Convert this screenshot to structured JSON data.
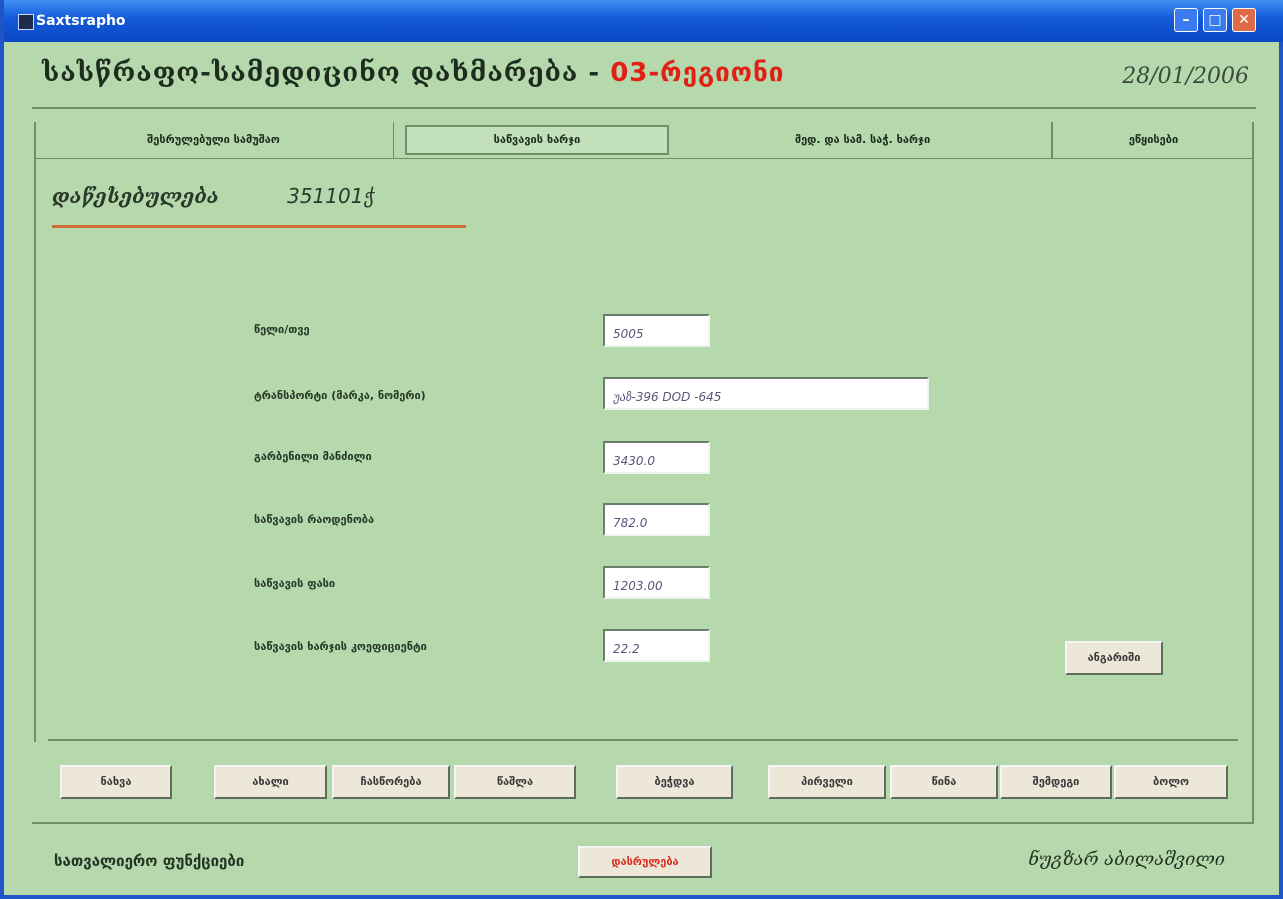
{
  "window": {
    "title": "Saxtsrapho"
  },
  "header": {
    "title_main": "სასწრაფო-სამედიცინო დახმარება - ",
    "title_accent": "03-რეგიონი",
    "date": "28/01/2006"
  },
  "tabs": [
    {
      "label": "შესრულებული სამუშაო"
    },
    {
      "label": "საწვავის ხარჯი"
    },
    {
      "label": "მედ. და სამ. საჭ. ხარჯი"
    },
    {
      "label": "ეწყისები"
    }
  ],
  "panel": {
    "label": "დაწესებულება",
    "code": "351101ჭ"
  },
  "fields": [
    {
      "label": "წელი/თვე",
      "value": "5005"
    },
    {
      "label": "ტრანსპორტი (მარკა, ნომერი)",
      "value": "უაზ-396 DOD -645"
    },
    {
      "label": "გარბენილი მანძილი",
      "value": "3430.0"
    },
    {
      "label": "საწვავის რაოდენობა",
      "value": "782.0"
    },
    {
      "label": "საწვავის ფასი",
      "value": "1203.00"
    },
    {
      "label": "საწვავის ხარჯის კოეფიციენტი",
      "value": "22.2"
    }
  ],
  "actions": {
    "recalc": "ანგარიში"
  },
  "toolbar": [
    {
      "label": "ნახვა"
    },
    {
      "label": "ახალი"
    },
    {
      "label": "ჩასწორება"
    },
    {
      "label": "წაშლა"
    },
    {
      "label": "ბეჭდვა"
    },
    {
      "label": "პირველი"
    },
    {
      "label": "წინა"
    },
    {
      "label": "შემდეგი"
    },
    {
      "label": "ბოლო"
    }
  ],
  "status": {
    "left": "სათვალიერო ფუნქციები",
    "exit": "დასრულება",
    "right": "ნუგზარ აბილაშვილი"
  },
  "colors": {
    "titlebar": "#0c48c4",
    "background": "#b5d9ad",
    "accent": "#e02015"
  }
}
